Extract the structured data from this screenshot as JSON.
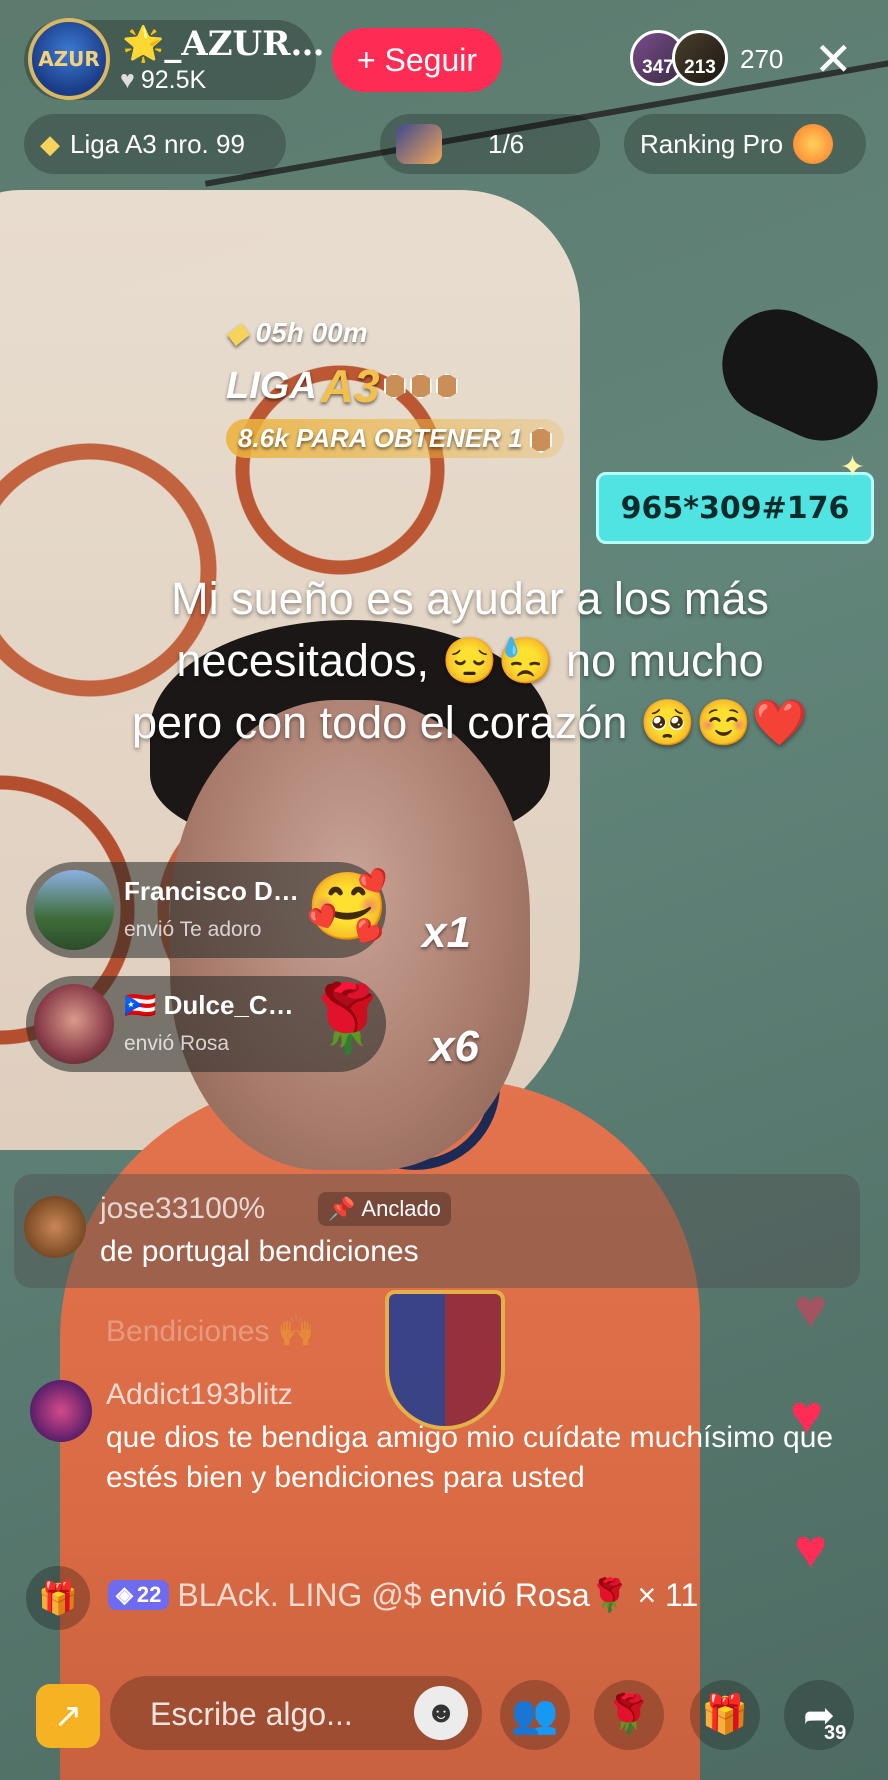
{
  "host": {
    "avatar_text": "AZUR",
    "name": "🌟_AZUR…",
    "likes": "92.5K"
  },
  "follow_button": {
    "label": "+ Seguir"
  },
  "viewers": {
    "a_badge": "347",
    "b_badge": "213",
    "count": "270"
  },
  "chips": {
    "league": "Liga A3 nro. 99",
    "pager": "1/6",
    "ranking": "Ranking Pro"
  },
  "league_widget": {
    "time": "05h 00m",
    "title_prefix": "LIGA",
    "title_rank": "A3",
    "goal": "8.6k PARA OBTENER 1"
  },
  "code_box": "965*309#176",
  "caption": "Mi sueño es ayudar a los más necesitados, 😔😓 no mucho pero con todo el corazón 🥺☺️❤️",
  "gifts": [
    {
      "name": "Francisco D…",
      "desc": "envió Te adoro",
      "emoji": "🥰",
      "count": "x1"
    },
    {
      "name": "🇵🇷 Dulce_C…",
      "desc": "envió Rosa",
      "emoji": "🌹",
      "count": "x6"
    }
  ],
  "comments": {
    "pinned": {
      "user": "jose33100%",
      "badge": "Anclado",
      "text": "de portugal bendiciones"
    },
    "faded": "Bendiciones 🙌",
    "second": {
      "user": "Addict193blitz",
      "text": "que dios te bendiga amigo mio cuídate muchísimo que estés bien y bendiciones para usted"
    }
  },
  "gift_line": {
    "level": "22",
    "user": "BLAck. LING @$",
    "action": "envió Rosa🌹",
    "count": "× 11"
  },
  "bottom": {
    "placeholder": "Escribe algo...",
    "share_count": "39"
  },
  "colors": {
    "follow": "#fe2c55",
    "code_box": "#4fe4e2",
    "heart": "#ff2d55",
    "league_gold": "#f3c14b"
  },
  "icons": {
    "likes": "heart-icon",
    "close": "close-icon",
    "league": "diamond-icon",
    "ranking": "flame-icon",
    "gift_box": "gift-icon",
    "pin": "pin-icon",
    "share": "share-arrow-icon"
  }
}
